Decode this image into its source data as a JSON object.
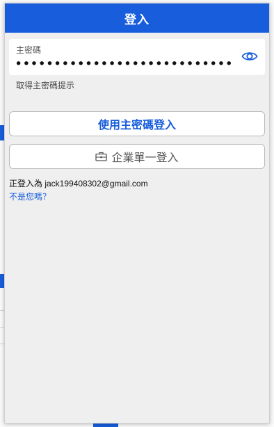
{
  "header": {
    "title": "登入"
  },
  "password": {
    "label": "主密碼",
    "masked_value": "••••••••••••••••••••••••••••••••••••"
  },
  "hint_link": "取得主密碼提示",
  "buttons": {
    "master_login": "使用主密碼登入",
    "sso_login": "企業單一登入"
  },
  "account": {
    "logged_in_as": "正登入為 jack199408302@gmail.com",
    "not_you": "不是您嗎？"
  },
  "colors": {
    "brand": "#175ddc",
    "panel": "#efefef"
  },
  "icons": [
    "eye-icon",
    "briefcase-icon"
  ]
}
